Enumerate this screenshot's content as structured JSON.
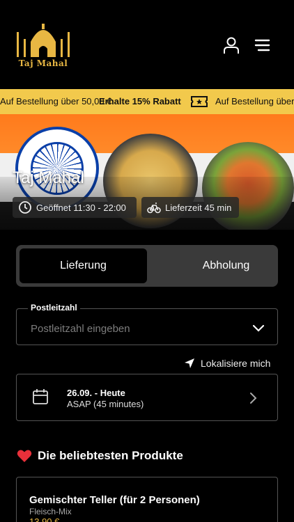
{
  "brand": {
    "name": "Taj Mahal",
    "logo_text": "Taj Mahal",
    "accent": "#f2c94c"
  },
  "promo": {
    "text_left": "Auf Bestellung über 50,00 €",
    "text_bold": "Erhalte 15% Rabatt",
    "text_right": "Auf Bestellung über",
    "icon": "ticket-icon"
  },
  "hero": {
    "title": "Taj Mahal",
    "opening_hours": "Geöffnet 11:30 - 22:00",
    "delivery_time": "Lieferzeit 45 min"
  },
  "order_mode": {
    "options": [
      "Lieferung",
      "Abholung"
    ],
    "selected": "Lieferung"
  },
  "postal": {
    "label": "Postleitzahl",
    "placeholder": "Postleitzahl eingeben"
  },
  "locate": {
    "label": "Lokalisiere mich"
  },
  "schedule": {
    "date": "26.09. - Heute",
    "time": "ASAP (45 minutes)"
  },
  "popular": {
    "title": "Die beliebtesten Produkte",
    "items": [
      {
        "name": "Gemischter Teller (für 2 Personen)",
        "description": "Fleisch-Mix",
        "price": "13,90 €"
      }
    ]
  }
}
